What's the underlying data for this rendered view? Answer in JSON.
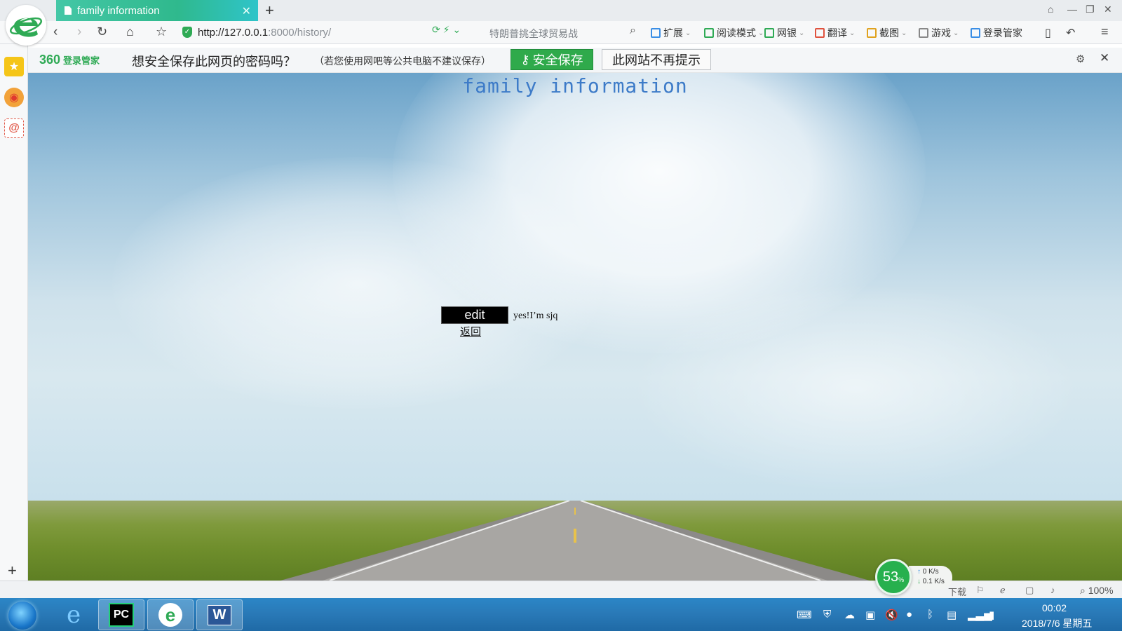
{
  "browser": {
    "tab_title": "family information",
    "new_tab": "+",
    "url_host": "http://127.0.0.1",
    "url_rest": ":8000/history/",
    "search_hint": "特朗普挑全球贸易战",
    "toolbar": [
      {
        "label": "扩展",
        "icon": "extensions-icon",
        "color": "#3a8ee6"
      },
      {
        "label": "阅读模式",
        "icon": "reader-icon",
        "color": "#2faa55"
      },
      {
        "label": "网银",
        "icon": "bank-icon",
        "color": "#2faa55"
      },
      {
        "label": "翻译",
        "icon": "translate-icon",
        "color": "#e0523e"
      },
      {
        "label": "截图",
        "icon": "screenshot-icon",
        "color": "#e0a21e"
      },
      {
        "label": "游戏",
        "icon": "games-icon",
        "color": "#888888"
      },
      {
        "label": "登录管家",
        "icon": "login-manager-icon",
        "color": "#3a8ee6"
      }
    ]
  },
  "password_bar": {
    "brand": "360",
    "brand_sub": "登录管家",
    "question": "想安全保存此网页的密码吗？",
    "note": "（若您使用网吧等公共电脑不建议保存）",
    "save_label": "安全保存",
    "never_label": "此网站不再提示"
  },
  "page": {
    "title": "family information",
    "edit_button": "edit",
    "message": "yes!I’m sjq",
    "back_link": "返回"
  },
  "status": {
    "download": "下载",
    "zoom": "100%",
    "cpu_percent": "53",
    "cpu_unit": "%",
    "upload_speed": "0 K/s",
    "download_speed": "0.1 K/s"
  },
  "taskbar": {
    "time": "00:02",
    "date": "2018/7/6 星期五"
  },
  "colors": {
    "accent_green": "#2faa4b",
    "title_blue": "#3d7bc8",
    "tab_teal": "#2fb98d"
  }
}
